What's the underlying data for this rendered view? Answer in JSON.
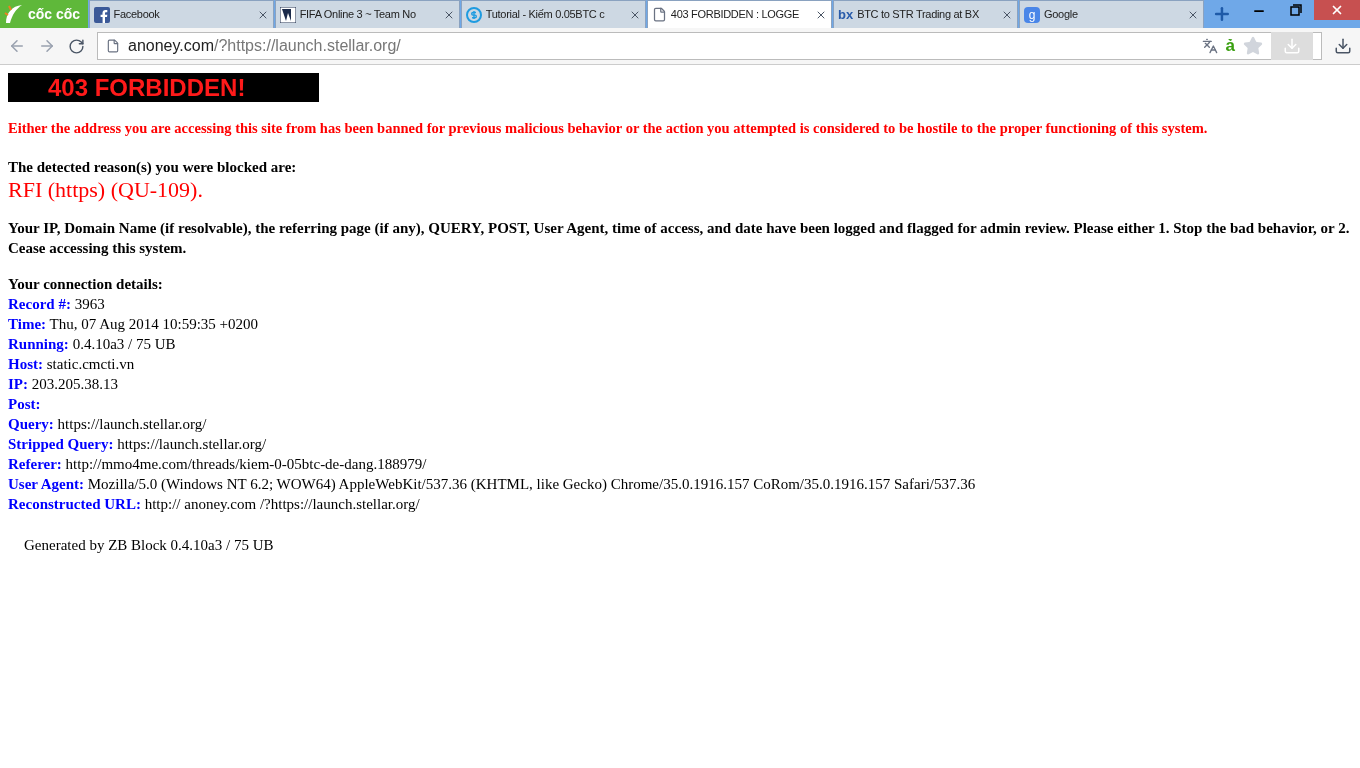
{
  "browser": {
    "logo": "cốc cốc",
    "tabs": [
      {
        "title": "Facebook",
        "selected": false
      },
      {
        "title": "FIFA Online 3 ~ Team No",
        "selected": false
      },
      {
        "title": "Tutorial - Kiếm 0.05BTC c",
        "selected": false
      },
      {
        "title": "403 FORBIDDEN : LOGGE",
        "selected": true
      },
      {
        "title": "BTC to STR Trading at BX",
        "logo_text": "bx",
        "selected": false
      },
      {
        "title": "Google",
        "logo_text": "g",
        "selected": false
      }
    ],
    "address": {
      "host": "anoney.com",
      "rest": "/?https://launch.stellar.org/"
    },
    "typing_button": "ả"
  },
  "page": {
    "banner": "403 FORBIDDEN!",
    "warning": "Either the address you are accessing this site from has been banned for previous malicious behavior or the action you attempted is considered to be hostile to the proper functioning of this system.",
    "reason_label": "The detected reason(s) you were blocked are:",
    "reason": "RFI (https) (QU-109).",
    "notice": "Your IP, Domain Name (if resolvable), the referring page (if any), QUERY, POST, User Agent, time of access, and date have been logged and flagged for admin review. Please either 1. Stop the bad behavior, or 2. Cease accessing this system.",
    "details_heading": "Your connection details:",
    "details": [
      {
        "label": "Record #:",
        "value": "3963"
      },
      {
        "label": "Time:",
        "value": "Thu, 07 Aug 2014 10:59:35 +0200"
      },
      {
        "label": "Running:",
        "value": "0.4.10a3 / 75 UB"
      },
      {
        "label": "Host:",
        "value": "static.cmcti.vn"
      },
      {
        "label": "IP:",
        "value": "203.205.38.13"
      },
      {
        "label": "Post:"
      },
      {
        "label": "Query:",
        "value": "https://launch.stellar.org/"
      },
      {
        "label": "Stripped Query:",
        "value": "https://launch.stellar.org/"
      },
      {
        "label": "Referer:",
        "value": "http://mmo4me.com/threads/kiem-0-05btc-de-dang.188979/"
      },
      {
        "label": "User Agent:",
        "value": "Mozilla/5.0 (Windows NT 6.2; WOW64) AppleWebKit/537.36 (KHTML, like Gecko) Chrome/35.0.1916.157 CoRom/35.0.1916.157 Safari/537.36"
      },
      {
        "label": "Reconstructed URL:",
        "value": "http:// anoney.com /?https://launch.stellar.org/"
      }
    ],
    "footer": "Generated by ZB Block 0.4.10a3 / 75 UB"
  }
}
